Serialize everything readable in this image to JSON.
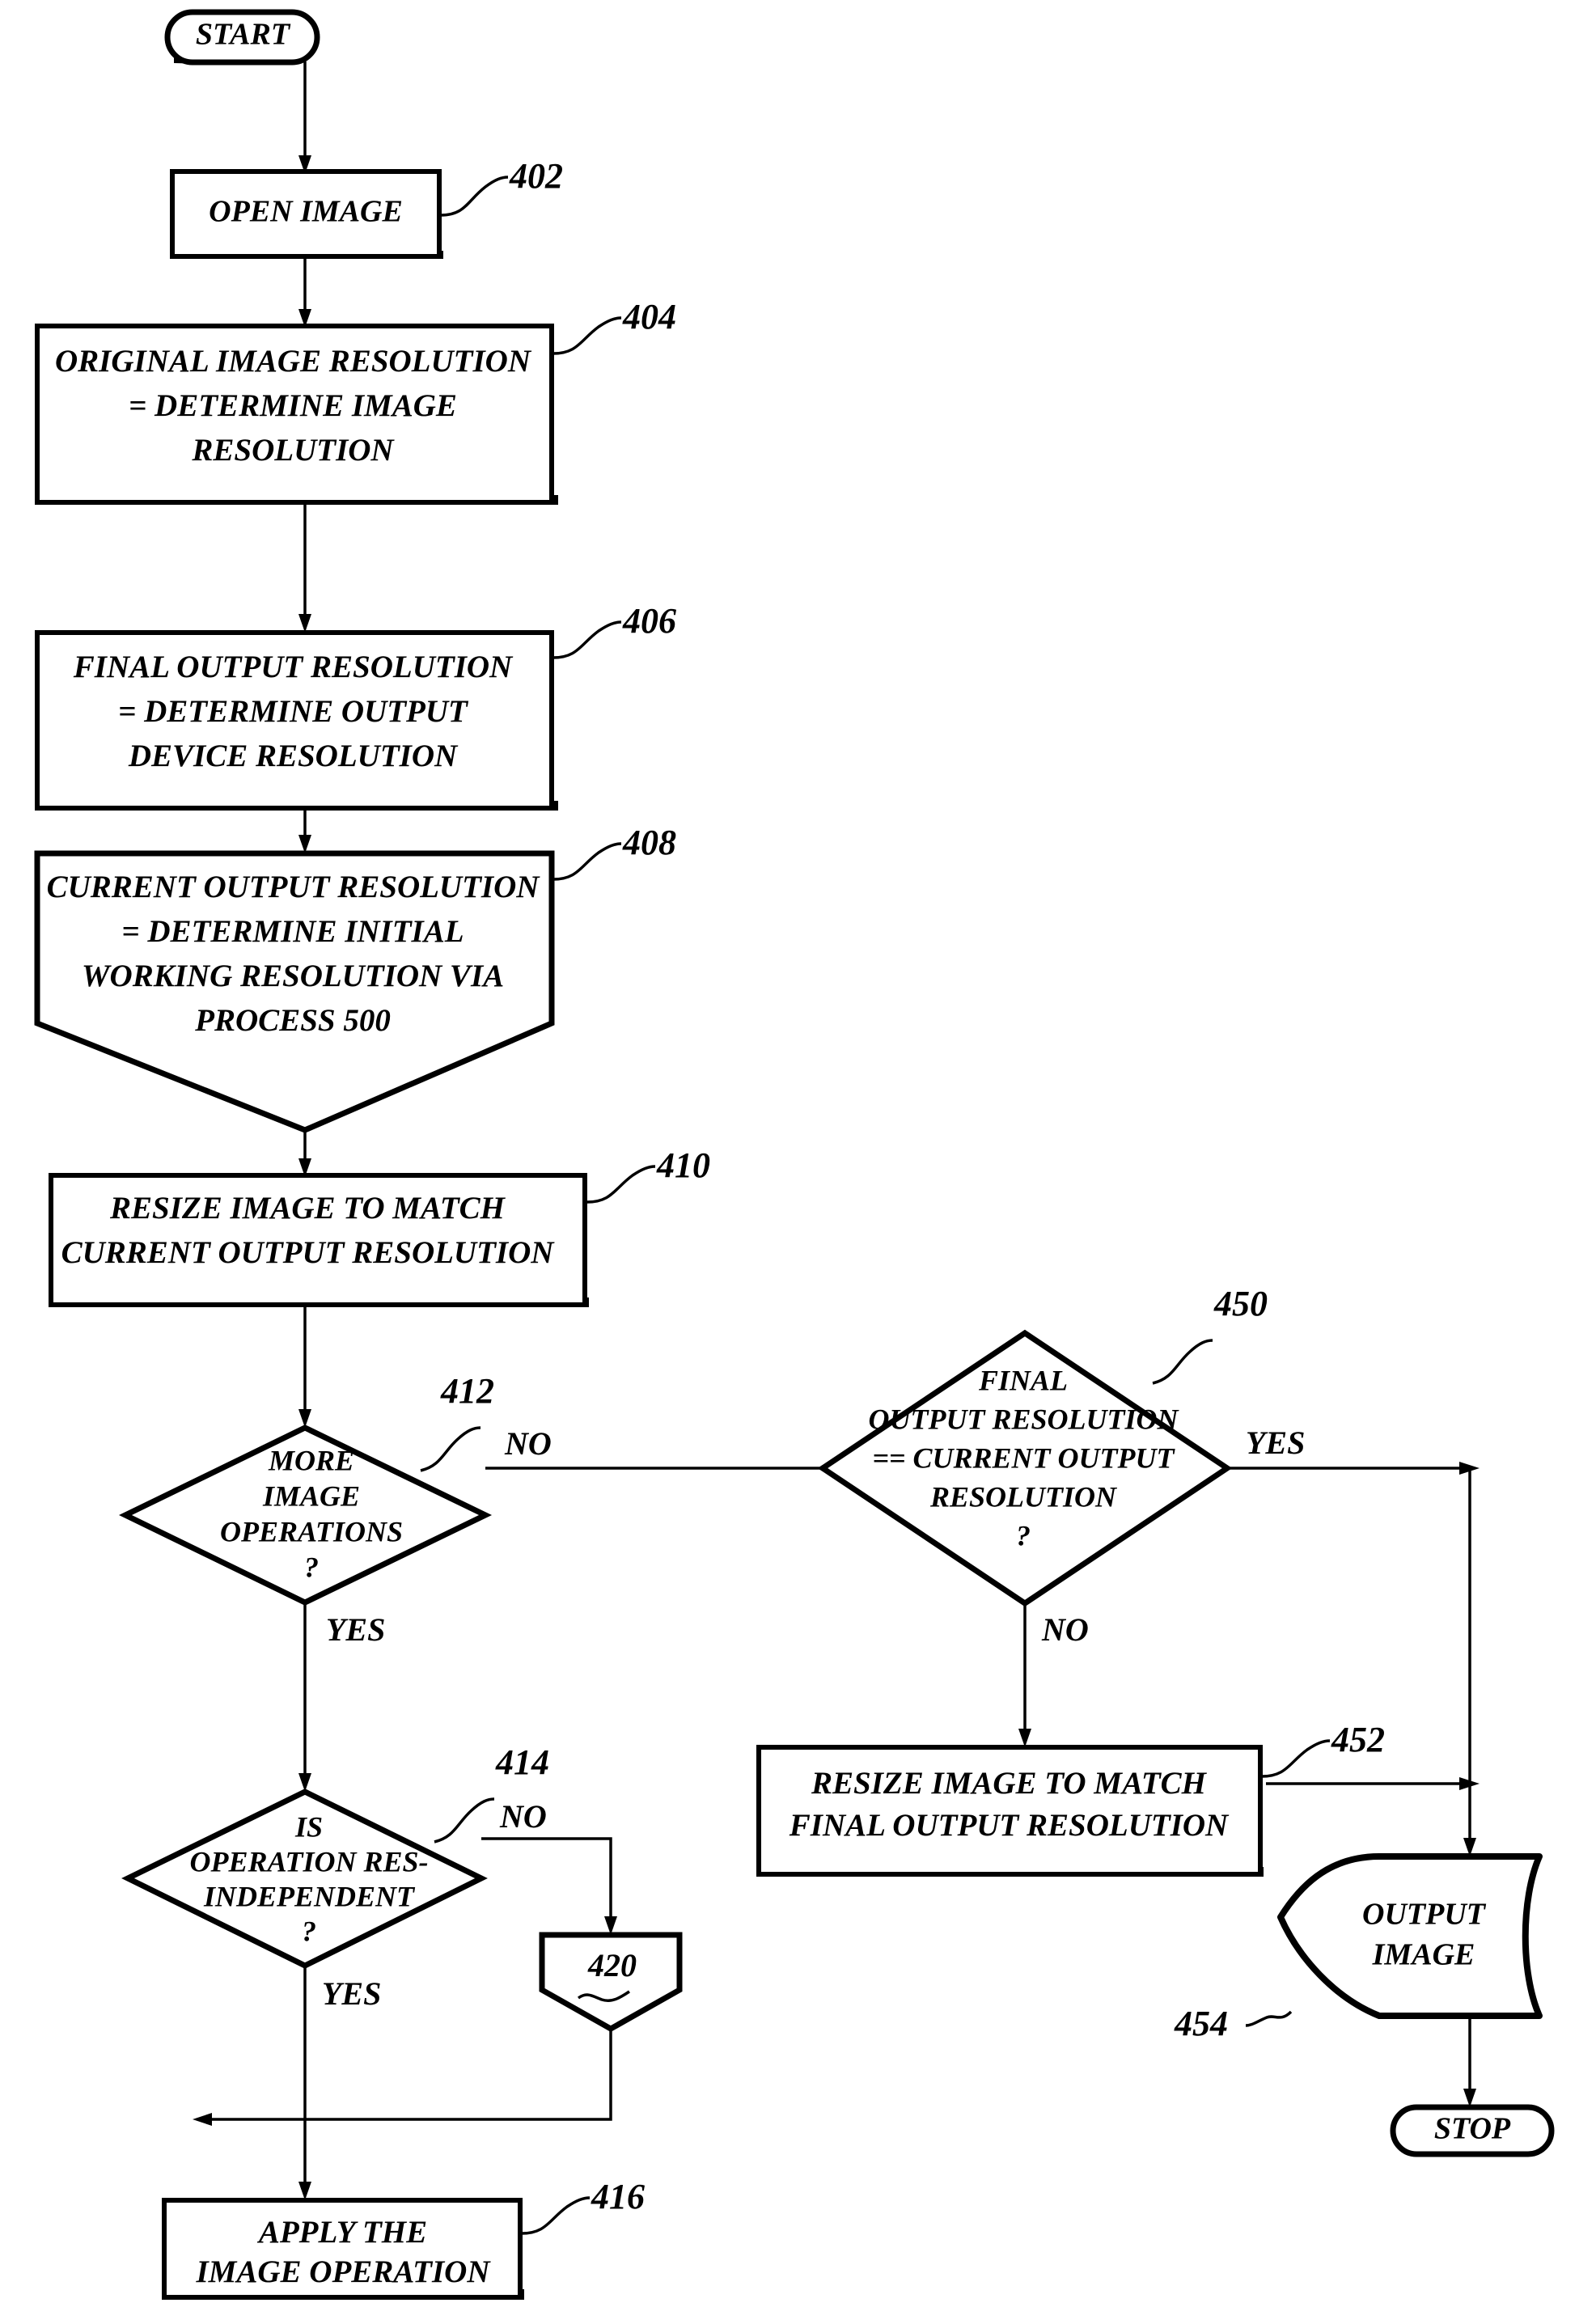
{
  "figure": {
    "type": "flowchart",
    "orientation": "two-column",
    "nodes": [
      {
        "id": "start",
        "ref": "",
        "shape": "terminator",
        "lines": [
          "START"
        ]
      },
      {
        "id": "open_image",
        "ref": "402",
        "shape": "process",
        "lines": [
          "OPEN IMAGE"
        ]
      },
      {
        "id": "original_res",
        "ref": "404",
        "shape": "process",
        "lines": [
          "ORIGINAL IMAGE RESOLUTION",
          "=  DETERMINE IMAGE",
          "RESOLUTION"
        ]
      },
      {
        "id": "final_res",
        "ref": "406",
        "shape": "process",
        "lines": [
          "FINAL OUTPUT RESOLUTION",
          "=  DETERMINE OUTPUT",
          "DEVICE RESOLUTION"
        ]
      },
      {
        "id": "current_res",
        "ref": "408",
        "shape": "pentagon-down",
        "lines": [
          "CURRENT OUTPUT RESOLUTION",
          "=  DETERMINE INITIAL",
          "WORKING RESOLUTION VIA",
          "PROCESS 500"
        ]
      },
      {
        "id": "resize_current",
        "ref": "410",
        "shape": "process",
        "lines": [
          "RESIZE IMAGE TO MATCH",
          "CURRENT OUTPUT RESOLUTION"
        ]
      },
      {
        "id": "more_ops",
        "ref": "412",
        "shape": "decision",
        "lines": [
          "MORE",
          "IMAGE",
          "OPERATIONS",
          "?"
        ]
      },
      {
        "id": "res_independent",
        "ref": "414",
        "shape": "decision",
        "lines": [
          "IS",
          "OPERATION RES-",
          "INDEPENDENT",
          "?"
        ]
      },
      {
        "id": "subprocess_420",
        "ref": "",
        "shape": "pentagon-down",
        "lines": [
          "420"
        ]
      },
      {
        "id": "apply_op",
        "ref": "416",
        "shape": "process",
        "lines": [
          "APPLY THE",
          "IMAGE OPERATION"
        ]
      },
      {
        "id": "final_eq_current",
        "ref": "450",
        "shape": "decision",
        "lines": [
          "FINAL",
          "OUTPUT RESOLUTION",
          "==  CURRENT OUTPUT",
          "RESOLUTION",
          "?"
        ]
      },
      {
        "id": "resize_final",
        "ref": "452",
        "shape": "process",
        "lines": [
          "RESIZE IMAGE TO MATCH",
          "FINAL OUTPUT RESOLUTION"
        ]
      },
      {
        "id": "output_image",
        "ref": "454",
        "shape": "output-data",
        "lines": [
          "OUTPUT",
          "IMAGE"
        ]
      },
      {
        "id": "stop",
        "ref": "",
        "shape": "terminator",
        "lines": [
          "STOP"
        ]
      }
    ],
    "branch_labels": {
      "more_ops_no": "NO",
      "more_ops_yes": "YES",
      "res_independent_no": "NO",
      "res_independent_yes": "YES",
      "final_eq_current_yes": "YES",
      "final_eq_current_no": "NO"
    },
    "reference_numerals": [
      "402",
      "404",
      "406",
      "408",
      "410",
      "412",
      "414",
      "416",
      "420",
      "450",
      "452",
      "454"
    ],
    "colors": {
      "ink": "#000000",
      "paper": "#ffffff"
    }
  }
}
